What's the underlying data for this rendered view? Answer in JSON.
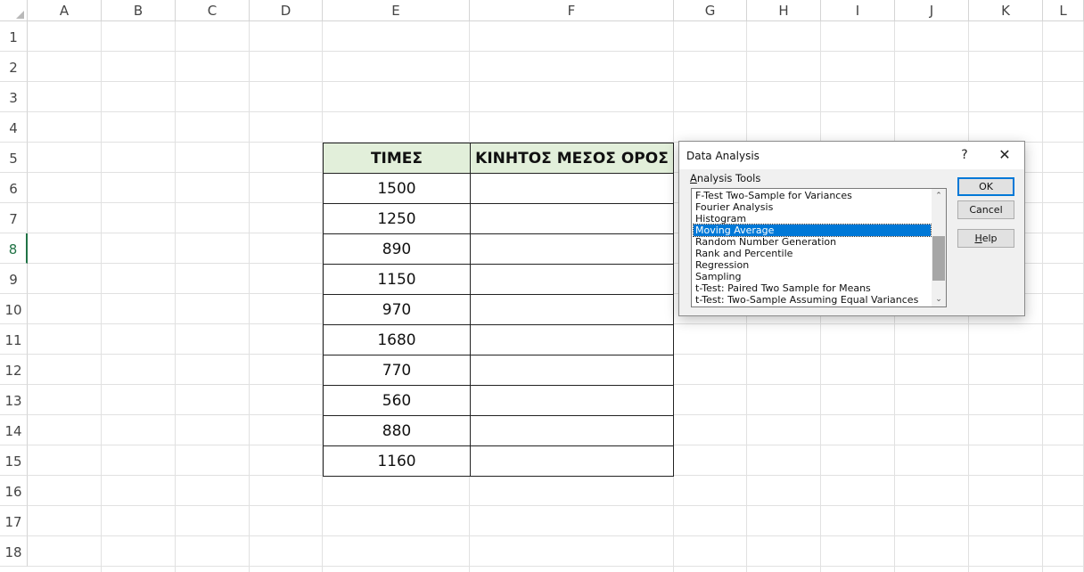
{
  "sheet": {
    "columns": [
      "A",
      "B",
      "C",
      "D",
      "E",
      "F",
      "G",
      "H",
      "I",
      "J",
      "K",
      "L"
    ],
    "rows": [
      "1",
      "2",
      "3",
      "4",
      "5",
      "6",
      "7",
      "8",
      "9",
      "10",
      "11",
      "12",
      "13",
      "14",
      "15",
      "16",
      "17",
      "18"
    ],
    "selected_row": "8"
  },
  "table": {
    "header_prices": "ΤΙΜΕΣ",
    "header_moving_avg": "ΚΙΝΗΤΟΣ ΜΕΣΟΣ ΟΡΟΣ",
    "prices": [
      "1500",
      "1250",
      "890",
      "1150",
      "970",
      "1680",
      "770",
      "560",
      "880",
      "1160"
    ]
  },
  "dialog": {
    "title": "Data Analysis",
    "help_symbol": "?",
    "close_symbol": "✕",
    "tools_label_first": "A",
    "tools_label_rest": "nalysis Tools",
    "tools": [
      "F-Test Two-Sample for Variances",
      "Fourier Analysis",
      "Histogram",
      "Moving Average",
      "Random Number Generation",
      "Rank and Percentile",
      "Regression",
      "Sampling",
      "t-Test: Paired Two Sample for Means",
      "t-Test: Two-Sample Assuming Equal Variances"
    ],
    "selected_tool": "Moving Average",
    "ok_label": "OK",
    "cancel_label": "Cancel",
    "help_first": "H",
    "help_rest": "elp",
    "scroll_up": "⌃",
    "scroll_down": "⌄"
  },
  "colors": {
    "header_fill": "#e2efda",
    "selection": "#0078d7",
    "excel_green": "#217346"
  }
}
